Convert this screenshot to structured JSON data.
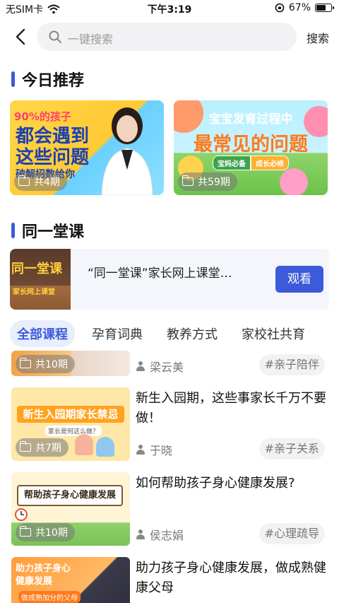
{
  "status_bar": {
    "carrier": "无SIM卡",
    "time": "下午3:19",
    "battery": "67%",
    "battery_level": 0.67
  },
  "search": {
    "placeholder": "一键搜索",
    "button": "搜索"
  },
  "sections": {
    "today": "今日推荐",
    "same_class": "同一堂课"
  },
  "recommend": [
    {
      "small": "90%的孩子",
      "big": "都会遇到这些问题",
      "sub": "破解招数给你",
      "count": "共4期"
    },
    {
      "small": "宝宝发育过程中",
      "big": "最常见的问题",
      "tag1": "宝妈必备",
      "tag2": "成长必修",
      "count": "共59期"
    }
  ],
  "same_class": {
    "thumb_title": "同一堂课",
    "thumb_sub": "家长网上课堂",
    "title": "“同一堂课”家长网上课堂…",
    "button": "观看"
  },
  "tabs": [
    "全部课程",
    "孕育词典",
    "教养方式",
    "家校社共育"
  ],
  "list": [
    {
      "count": "共10期",
      "author": "梁云美",
      "tag": "#亲子陪伴"
    },
    {
      "title": "新生入园期，这些事家长千万不要做！",
      "thumb_title": "新生入园期家长禁忌",
      "thumb_sub": "家长是何这么做？",
      "count": "共7期",
      "author": "于晓",
      "tag": "#亲子关系"
    },
    {
      "title": "如何帮助孩子身心健康发展?",
      "thumb_title": "帮助孩子身心健康发展",
      "count": "共10期",
      "author": "侯志娟",
      "tag": "#心理疏导"
    },
    {
      "title": "助力孩子身心健康发展，做成熟健康父母",
      "thumb_title": "助力孩子身心健康发展",
      "thumb_sub": "做成熟加分的父母"
    }
  ],
  "colors": {
    "accent": "#3b5bdb"
  }
}
